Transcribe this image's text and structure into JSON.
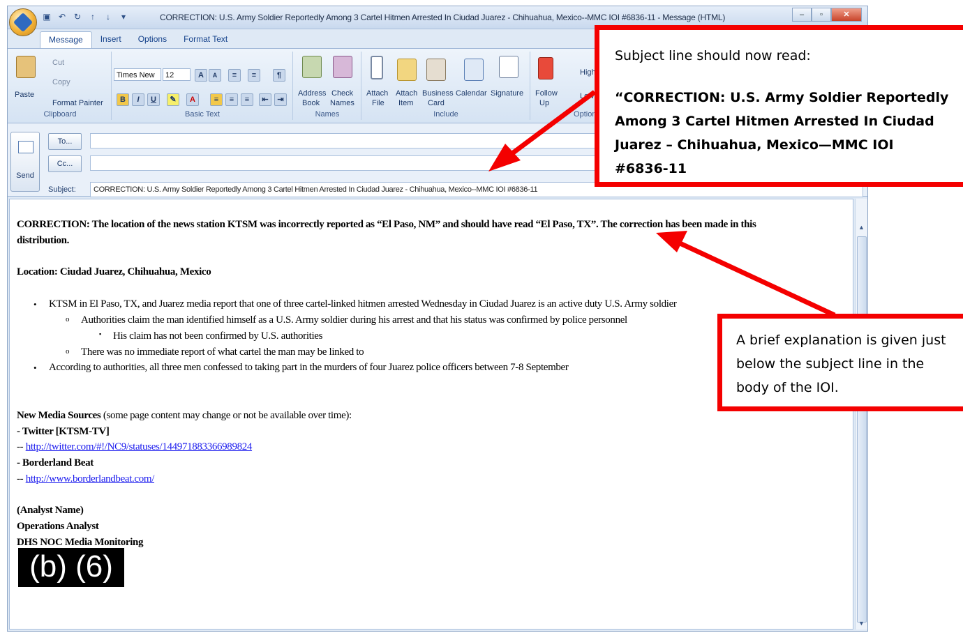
{
  "window": {
    "title": "CORRECTION: U.S. Army Soldier Reportedly Among 3 Cartel Hitmen Arrested In Ciudad Juarez - Chihuahua, Mexico--MMC IOI #6836-11 - Message (HTML)"
  },
  "tabs": [
    "Message",
    "Insert",
    "Options",
    "Format Text"
  ],
  "ribbon": {
    "clipboard": {
      "paste": "Paste",
      "cut": "Cut",
      "copy": "Copy",
      "format_painter": "Format Painter",
      "label": "Clipboard"
    },
    "basic_text": {
      "font": "Times New",
      "size": "12",
      "label": "Basic Text"
    },
    "names": {
      "address_book": [
        "Address",
        "Book"
      ],
      "check_names": [
        "Check",
        "Names"
      ],
      "label": "Names"
    },
    "include": {
      "attach_file": [
        "Attach",
        "File"
      ],
      "attach_item": [
        "Attach",
        "Item"
      ],
      "business_card": [
        "Business",
        "Card"
      ],
      "calendar": "Calendar",
      "signature": "Signature",
      "label": "Include"
    },
    "options": {
      "follow_up": [
        "Follow",
        "Up"
      ],
      "high": "High",
      "low": "Low",
      "label": "Options"
    }
  },
  "header": {
    "send": "Send",
    "to": "To...",
    "cc": "Cc...",
    "subject_label": "Subject:",
    "subject": "CORRECTION: U.S. Army Soldier Reportedly Among 3 Cartel Hitmen Arrested In Ciudad Juarez - Chihuahua, Mexico--MMC IOI #6836-11"
  },
  "body": {
    "correction_1": "CORRECTION: The location of the news station KTSM was incorrectly reported as “El Paso, NM” and should have read “El Paso, TX”. The correction has been made in this",
    "correction_2": "distribution.",
    "location": "Location: Ciudad Juarez, Chihuahua, Mexico",
    "bullet1": "KTSM in El Paso, TX, and Juarez media report that one of three cartel-linked hitmen arrested Wednesday in Ciudad Juarez is an active duty U.S. Army soldier",
    "sub1": "Authorities claim the man identified himself as a U.S. Army soldier during his arrest and that his status was confirmed by police personnel",
    "subsub1": "His claim has not been confirmed by U.S. authorities",
    "sub2": "There was no immediate report of what cartel the man may be linked to",
    "bullet2": "According to authorities, all three men confessed to taking part in the murders of four Juarez police officers between 7-8 September",
    "sources_bold": "New Media Sources",
    "sources_rest": " (some page content may change or not be available over time):",
    "src1": "- Twitter [KTSM-TV]",
    "src1_prefix": "-- ",
    "src1_link": "http://twitter.com/#!/NC9/statuses/144971883366989824",
    "src2": "- Borderland Beat",
    "src2_prefix": "-- ",
    "src2_link": "http://www.borderlandbeat.com/",
    "sig1": "(Analyst Name)",
    "sig2": "Operations Analyst",
    "sig3": "DHS NOC Media Monitoring",
    "redaction": "(b) (6)"
  },
  "annotations": {
    "callout1_intro": "Subject line should now read:",
    "callout1_quote": "“CORRECTION: U.S. Army Soldier Reportedly Among 3 Cartel Hitmen Arrested In Ciudad Juarez – Chihuahua, Mexico—MMC IOI #6836-11",
    "callout2": "A brief explanation is given just below the subject line in the body of the IOI.",
    "accent_color": "#f40000"
  }
}
